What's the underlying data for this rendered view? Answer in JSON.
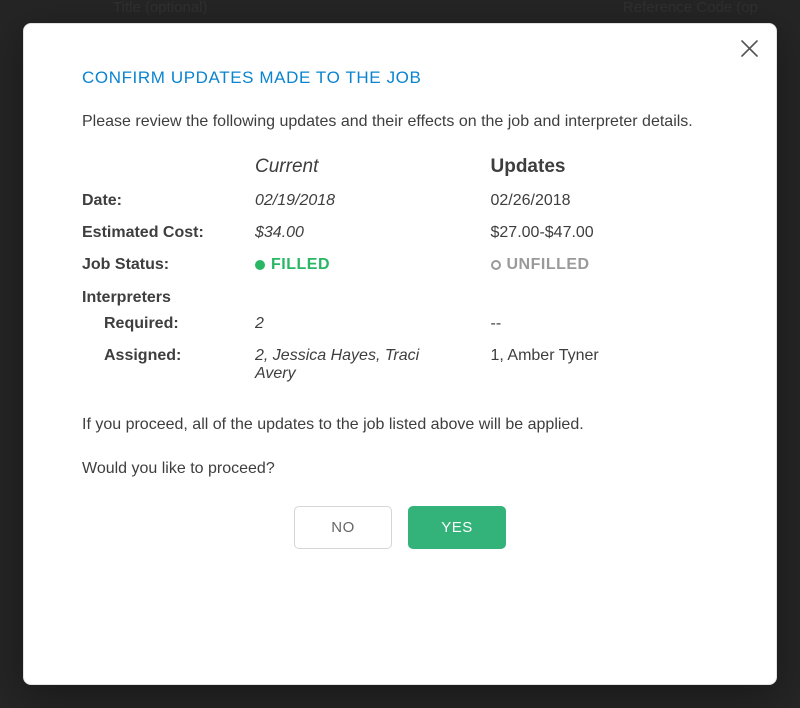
{
  "background": {
    "title_label": "Title (optional)",
    "refcode_label": "Reference Code (op"
  },
  "modal": {
    "title": "CONFIRM UPDATES MADE TO THE JOB",
    "intro": "Please review the following updates and their effects on the job and interpreter details.",
    "col_current": "Current",
    "col_updates": "Updates",
    "rows": {
      "date_label": "Date:",
      "date_current": "02/19/2018",
      "date_updates": "02/26/2018",
      "cost_label": "Estimated Cost:",
      "cost_current": "$34.00",
      "cost_updates": "$27.00-$47.00",
      "status_label": "Job Status:",
      "status_current": "FILLED",
      "status_updates": "UNFILLED",
      "interp_label": "Interpreters",
      "required_label": "Required:",
      "required_current": "2",
      "required_updates": "--",
      "assigned_label": "Assigned:",
      "assigned_current": "2, Jessica Hayes, Traci Avery",
      "assigned_updates": "1, Amber Tyner"
    },
    "footer_text": "If you proceed, all of the updates to the job listed above will be applied.",
    "proceed_q": "Would you like to proceed?",
    "no_label": "NO",
    "yes_label": "YES"
  }
}
